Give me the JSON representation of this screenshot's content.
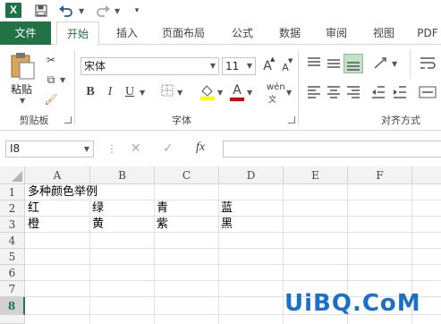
{
  "qat": {
    "app_icon_letter": "X",
    "icons": [
      "save-icon",
      "undo-icon",
      "redo-icon",
      "customize-icon"
    ]
  },
  "tabs": {
    "file": "文件",
    "items": [
      "开始",
      "插入",
      "页面布局",
      "公式",
      "数据",
      "审阅",
      "视图",
      "PDF"
    ],
    "active_index": 0
  },
  "ribbon": {
    "clipboard": {
      "paste_label": "粘贴",
      "group_label": "剪贴板"
    },
    "font": {
      "group_label": "字体",
      "font_name": "宋体",
      "font_size": "11",
      "bold": "B",
      "italic": "I",
      "underline": "U",
      "grow": "A",
      "shrink": "A",
      "font_color_letter": "A",
      "phonetic": "wén"
    },
    "alignment": {
      "group_label": "对齐方式"
    }
  },
  "formula_bar": {
    "name_box": "I8",
    "fx_label": "fx",
    "formula": ""
  },
  "sheet": {
    "columns": [
      "A",
      "B",
      "C",
      "D",
      "E",
      "F"
    ],
    "rows": [
      "1",
      "2",
      "3",
      "4",
      "5",
      "6",
      "7",
      "8"
    ],
    "active_row": "8",
    "cells": {
      "A1": "多种颜色举例",
      "A2": "红",
      "B2": "绿",
      "C2": "青",
      "D2": "蓝",
      "A3": "橙",
      "B3": "黄",
      "C3": "紫",
      "D3": "黑"
    }
  },
  "watermark": "UiBQ.CoM",
  "colors": {
    "excel_green": "#217346",
    "highlight_yellow": "#ffff00",
    "font_red": "#e00000",
    "watermark_blue": "#1a6fc8"
  }
}
